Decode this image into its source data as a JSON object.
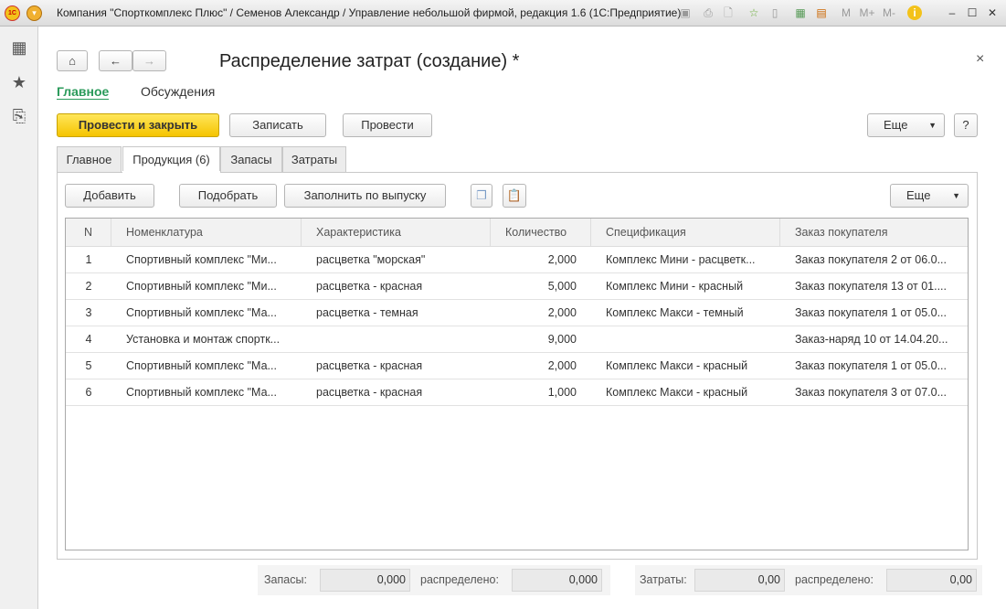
{
  "window": {
    "title": "Компания \"Спорткомплекс Плюс\" / Семенов Александр / Управление небольшой фирмой, редакция 1.6  (1С:Предприятие)",
    "toolbar_labels": [
      "M",
      "M+",
      "M-"
    ]
  },
  "header": {
    "title": "Распределение затрат (создание) *",
    "nav_links": [
      "Главное",
      "Обсуждения"
    ]
  },
  "commands": {
    "post_close": "Провести и закрыть",
    "save": "Записать",
    "post": "Провести",
    "more": "Еще",
    "help": "?"
  },
  "tabs": [
    "Главное",
    "Продукция (6)",
    "Запасы",
    "Затраты"
  ],
  "table_toolbar": {
    "add": "Добавить",
    "pick": "Подобрать",
    "fill": "Заполнить по выпуску",
    "more": "Еще"
  },
  "table": {
    "columns": [
      "N",
      "Номенклатура",
      "Характеристика",
      "Количество",
      "Спецификация",
      "Заказ покупателя"
    ],
    "rows": [
      [
        "1",
        "Спортивный комплекс \"Ми...",
        "расцветка \"морская\"",
        "2,000",
        "Комплекс Мини - расцветк...",
        "Заказ покупателя 2 от 06.0..."
      ],
      [
        "2",
        "Спортивный комплекс \"Ми...",
        "расцветка - красная",
        "5,000",
        "Комплекс Мини - красный",
        "Заказ покупателя 13 от 01...."
      ],
      [
        "3",
        "Спортивный комплекс \"Ма...",
        "расцветка - темная",
        "2,000",
        "Комплекс Макси - темный",
        "Заказ покупателя 1 от 05.0..."
      ],
      [
        "4",
        "Установка и монтаж спортк...",
        "",
        "9,000",
        "",
        "Заказ-наряд 10 от 14.04.20..."
      ],
      [
        "5",
        "Спортивный комплекс \"Ма...",
        "расцветка - красная",
        "2,000",
        "Комплекс Макси - красный",
        "Заказ покупателя 1 от 05.0..."
      ],
      [
        "6",
        "Спортивный комплекс \"Ма...",
        "расцветка - красная",
        "1,000",
        "Комплекс Макси - красный",
        "Заказ покупателя 3 от 07.0..."
      ]
    ]
  },
  "footer": {
    "stock_label": "Запасы:",
    "stock_value": "0,000",
    "stock_dist_label": "распределено:",
    "stock_dist_value": "0,000",
    "costs_label": "Затраты:",
    "costs_value": "0,00",
    "costs_dist_label": "распределено:",
    "costs_dist_value": "0,00"
  }
}
